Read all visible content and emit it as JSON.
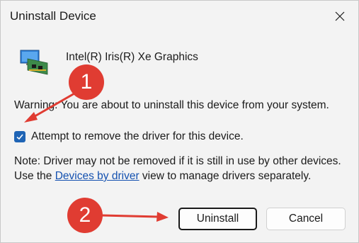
{
  "window": {
    "title": "Uninstall Device"
  },
  "device": {
    "name": "Intel(R) Iris(R) Xe Graphics",
    "icon": "display-adapter-icon"
  },
  "warning": {
    "text": "Warning: You are about to uninstall this device from your system."
  },
  "checkbox": {
    "label": "Attempt to remove the driver for this device.",
    "checked": true
  },
  "note": {
    "prefix": "Note: Driver may not be removed if it is still in use by other devices. Use the ",
    "link": "Devices by driver",
    "suffix": " view to manage drivers separately."
  },
  "buttons": {
    "uninstall": "Uninstall",
    "cancel": "Cancel"
  },
  "annotations": [
    {
      "label": "1",
      "color": "#e03c32"
    },
    {
      "label": "2",
      "color": "#e03c32"
    }
  ],
  "colors": {
    "accent": "#1f64b5",
    "link": "#1451b0",
    "annotation": "#e03c32"
  }
}
